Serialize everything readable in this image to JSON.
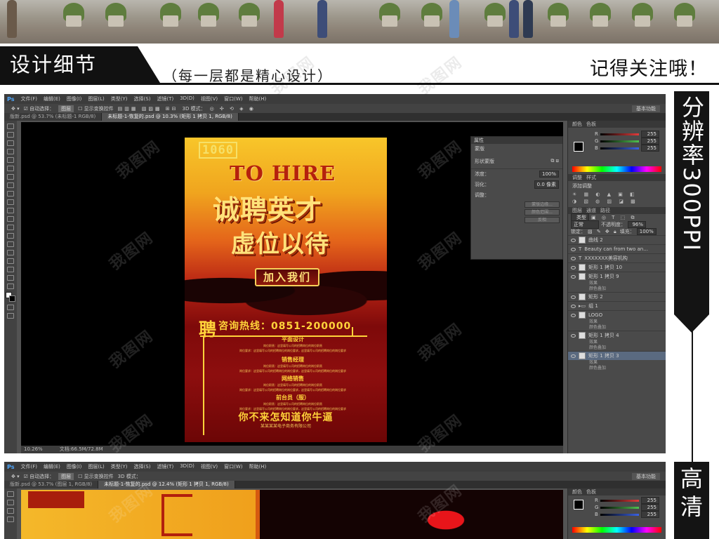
{
  "header": {
    "title": "设计细节",
    "subtitle": "（每一层都是精心设计）",
    "follow": "记得关注哦！"
  },
  "side_labels": {
    "resolution": "分辨率300PPI",
    "hd": "高清"
  },
  "watermark": "我图网",
  "ps": {
    "logo": "Ps",
    "menus": [
      "文件(F)",
      "编辑(E)",
      "图像(I)",
      "图层(L)",
      "类型(Y)",
      "选择(S)",
      "滤镜(T)",
      "3D(D)",
      "视图(V)",
      "窗口(W)",
      "帮助(H)"
    ],
    "options": {
      "auto_select": "自动选择：",
      "auto_select_value": "图层",
      "transform": "显示变换控件",
      "mode_3d": "3D 模式：",
      "workspace": "基本功能"
    },
    "tabs": [
      "版新.psd @ 53.7% (未标题-1 RGB/8)",
      "未标题-1-恢复的.psd @ 10.3% (矩形 1 拷贝 1, RGB/8)"
    ],
    "tabs2": [
      "版新.psd @ 53.7% (图层 1, RGB/8)",
      "未标题-1-恢复的.psd @ 12.4% (矩形 1 拷贝 1, RGB/8)"
    ],
    "status": {
      "zoom": "10.26%",
      "doc": "文档:66.5M/72.8M"
    },
    "properties": {
      "title": "属性",
      "mask_label": "蒙版",
      "vector_mask": "形状蒙版",
      "density_label": "浓度：",
      "density_value": "100%",
      "feather_label": "羽化：",
      "feather_value": "0.0 像素",
      "adjust_label": "调整：",
      "buttons": [
        "蒙版边缘...",
        "颜色范围...",
        "反相"
      ]
    },
    "color_panel": {
      "tabs": [
        "颜色",
        "色板"
      ],
      "channels": [
        {
          "label": "R",
          "value": "255",
          "color": "#e33b3b"
        },
        {
          "label": "G",
          "value": "255",
          "color": "#4fc24f"
        },
        {
          "label": "B",
          "value": "255",
          "color": "#3b62e3"
        }
      ]
    },
    "adjust_panel": {
      "tabs": [
        "调整",
        "样式"
      ],
      "add": "添加调整"
    },
    "layers_panel": {
      "tabs": [
        "图层",
        "通道",
        "路径"
      ],
      "kind": "类型",
      "blend": "正常",
      "opacity_label": "不透明度：",
      "opacity_value": "96%",
      "lock_label": "锁定：",
      "fill_label": "填充：",
      "fill_value": "100%",
      "layers": [
        {
          "name": "曲线 2",
          "type": "adj",
          "sub": []
        },
        {
          "name": "Beauty can from two an...",
          "type": "text",
          "sub": []
        },
        {
          "name": "XXXXXXX美容机构",
          "type": "text",
          "sub": []
        },
        {
          "name": "矩形 1 拷贝 10",
          "type": "shape",
          "sub": []
        },
        {
          "name": "矩形 1 拷贝 9",
          "type": "shape",
          "sub": [
            "效果",
            "颜色叠加"
          ]
        },
        {
          "name": "矩形 2",
          "type": "shape",
          "sub": []
        },
        {
          "name": "组 1",
          "type": "group",
          "sub": []
        },
        {
          "name": "LOGO",
          "type": "shape",
          "sub": [
            "效果",
            "颜色叠加"
          ]
        },
        {
          "name": "矩形 1 拷贝 4",
          "type": "shape",
          "sub": [
            "效果",
            "颜色叠加"
          ]
        },
        {
          "name": "矩形 1 拷贝 3",
          "type": "shape",
          "sub": [
            "效果",
            "颜色叠加"
          ],
          "selected": true
        }
      ]
    }
  },
  "poster": {
    "code": "1060",
    "en_title": "TO HIRE",
    "title1": "诚聘英才",
    "title2": "虚位以待",
    "join_button": "加入我们",
    "ping": "聘",
    "hotline": "咨询热线：0851-200000",
    "jobs": [
      {
        "title": "平面设计",
        "lines": [
          "岗位职责：这里填写公司的招聘岗位的岗位职责",
          "岗位要求：这里填写公司的招聘岗位的岗位要求，这里填写公司的招聘岗位的岗位要求"
        ]
      },
      {
        "title": "销售经理",
        "lines": [
          "岗位职责：这里填写公司的招聘岗位的岗位职责",
          "岗位要求：这里填写公司的招聘岗位的岗位要求，这里填写公司的招聘岗位的岗位要求"
        ]
      },
      {
        "title": "网络销售",
        "lines": [
          "岗位职责：这里填写公司的招聘岗位的岗位职责",
          "岗位要求：这里填写公司的招聘岗位的岗位要求，这里填写公司的招聘岗位的岗位要求"
        ]
      },
      {
        "title": "前台员（服）",
        "lines": [
          "岗位职责：这里填写公司的招聘岗位的岗位职责",
          "岗位要求：这里填写公司的招聘岗位的岗位要求，这里填写公司的招聘岗位的岗位要求"
        ]
      }
    ],
    "slogan": "你不来怎知道你牛逼",
    "company": "某某某某电子商务有限公司"
  }
}
